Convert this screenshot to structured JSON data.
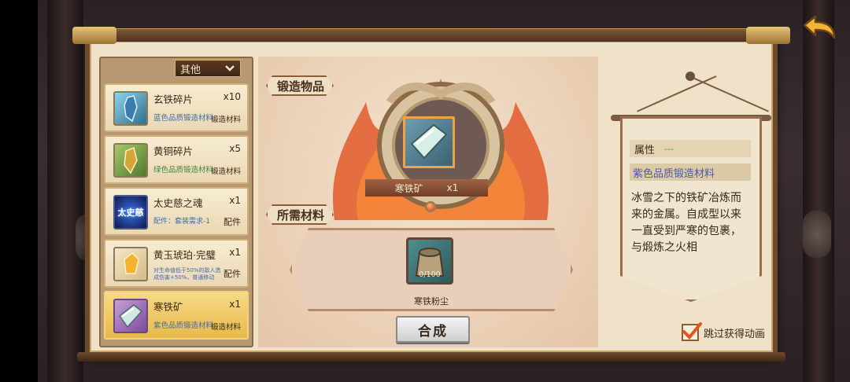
{
  "dropdown": {
    "selected": "其他"
  },
  "items": [
    {
      "name": "玄铁碎片",
      "qty": "x10",
      "sub": "蓝色品质锻造材料",
      "kind": "锻造材料",
      "icon": "blue-crystal-icon"
    },
    {
      "name": "黄铜碎片",
      "qty": "x5",
      "sub": "绿色品质锻造材料",
      "kind": "锻造材料",
      "icon": "gold-crystal-icon"
    },
    {
      "name": "太史慈之魂",
      "qty": "x1",
      "sub": "配件：套装需求-1",
      "kind": "配件",
      "icon": "soul-icon",
      "icon_text": "太史慈"
    },
    {
      "name": "黄玉琥珀·完璧",
      "qty": "x1",
      "sub": "对生命值低于50%的敌人造成伤害+50%，普通移动",
      "kind": "配件",
      "icon": "amber-gem-icon"
    },
    {
      "name": "寒铁矿",
      "qty": "x1",
      "sub": "紫色品质锻造材料",
      "kind": "锻造材料",
      "icon": "cold-iron-ore-icon",
      "selected": true
    }
  ],
  "forge": {
    "section_label": "锻造物品",
    "target_name": "寒铁矿",
    "target_qty": "x1"
  },
  "materials": {
    "section_label": "所需材料",
    "name": "寒铁粉尘",
    "count": "0/100"
  },
  "compose_label": "合成",
  "detail": {
    "attr_label": "属性",
    "attr_value": "---",
    "quality": "紫色品质锻造材料",
    "description": "冰雪之下的铁矿冶炼而来的金属。自成型以来一直受到严寒的包裹，与煅炼之火相"
  },
  "skip_animation": {
    "label": "跳过获得动画",
    "checked": true
  },
  "colors": {
    "selected_item": "#f0c14e",
    "quality_purple": "#4d58a8",
    "checkbox_mark": "#e2561c"
  }
}
